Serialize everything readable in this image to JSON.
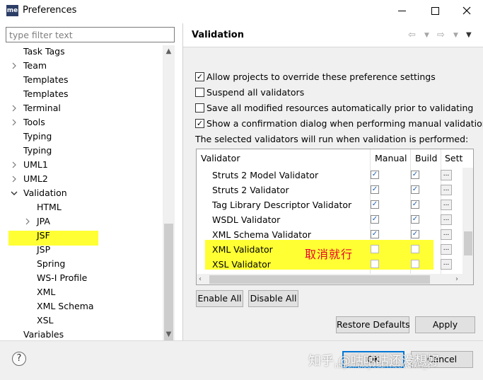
{
  "window": {
    "app_icon": "me",
    "title": "Preferences"
  },
  "filter": {
    "placeholder": "type filter text"
  },
  "tree": [
    {
      "label": "Task Tags",
      "expandable": false,
      "level": 0
    },
    {
      "label": "Team",
      "expandable": true,
      "level": 0
    },
    {
      "label": "Templates",
      "expandable": false,
      "level": 0
    },
    {
      "label": "Templates",
      "expandable": false,
      "level": 0
    },
    {
      "label": "Terminal",
      "expandable": true,
      "level": 0
    },
    {
      "label": "Tools",
      "expandable": true,
      "level": 0
    },
    {
      "label": "Typing",
      "expandable": false,
      "level": 0
    },
    {
      "label": "Typing",
      "expandable": false,
      "level": 0
    },
    {
      "label": "UML1",
      "expandable": true,
      "level": 0
    },
    {
      "label": "UML2",
      "expandable": true,
      "level": 0
    },
    {
      "label": "Validation",
      "expandable": true,
      "expanded": true,
      "selected": true,
      "level": 0
    },
    {
      "label": "HTML",
      "expandable": false,
      "level": 1
    },
    {
      "label": "JPA",
      "expandable": true,
      "level": 1
    },
    {
      "label": "JSF",
      "expandable": false,
      "level": 1
    },
    {
      "label": "JSP",
      "expandable": false,
      "level": 1
    },
    {
      "label": "Spring",
      "expandable": false,
      "level": 1
    },
    {
      "label": "WS-I Profile",
      "expandable": false,
      "level": 1
    },
    {
      "label": "XML",
      "expandable": false,
      "level": 1
    },
    {
      "label": "XML Schema",
      "expandable": false,
      "level": 1
    },
    {
      "label": "XSL",
      "expandable": false,
      "level": 1
    },
    {
      "label": "Variables",
      "expandable": false,
      "level": 0
    }
  ],
  "page": {
    "title": "Validation",
    "options": [
      {
        "label": "Allow projects to override these preference settings",
        "checked": true
      },
      {
        "label": "Suspend all validators",
        "checked": false
      },
      {
        "label": "Save all modified resources automatically prior to validating",
        "checked": false
      },
      {
        "label": "Show a confirmation dialog when performing manual validations",
        "checked": true
      }
    ],
    "info": "The selected validators will run when validation is performed:",
    "table": {
      "columns": [
        "Validator",
        "Manual",
        "Build",
        "Setti"
      ],
      "rows": [
        {
          "name": "Struts 2 Model Validator",
          "manual": true,
          "build": true,
          "settings": "..."
        },
        {
          "name": "Struts 2 Validator",
          "manual": true,
          "build": true,
          "settings": "..."
        },
        {
          "name": "Tag Library Descriptor Validator",
          "manual": true,
          "build": true,
          "settings": "..."
        },
        {
          "name": "WSDL Validator",
          "manual": true,
          "build": true,
          "settings": "..."
        },
        {
          "name": "XML Schema Validator",
          "manual": true,
          "build": true,
          "settings": "..."
        },
        {
          "name": "XML Validator",
          "manual": false,
          "build": false,
          "settings": "..."
        },
        {
          "name": "XSL Validator",
          "manual": false,
          "build": false,
          "settings": "..."
        }
      ]
    },
    "annotation": "取消就行",
    "highlight_color": "#ffff33",
    "enable_all": "Enable All",
    "disable_all": "Disable All",
    "restore_defaults": "Restore Defaults",
    "apply": "Apply"
  },
  "footer": {
    "ok": "OK",
    "cancel": "Cancel",
    "watermark": "知乎 @咕咕咕还没想好",
    "watermark_url": "https://blog.csdn.net/weixin_4"
  },
  "icons": {
    "help": "?",
    "check": "✓",
    "chevron_right": "›",
    "chevron_down": "⌄"
  }
}
